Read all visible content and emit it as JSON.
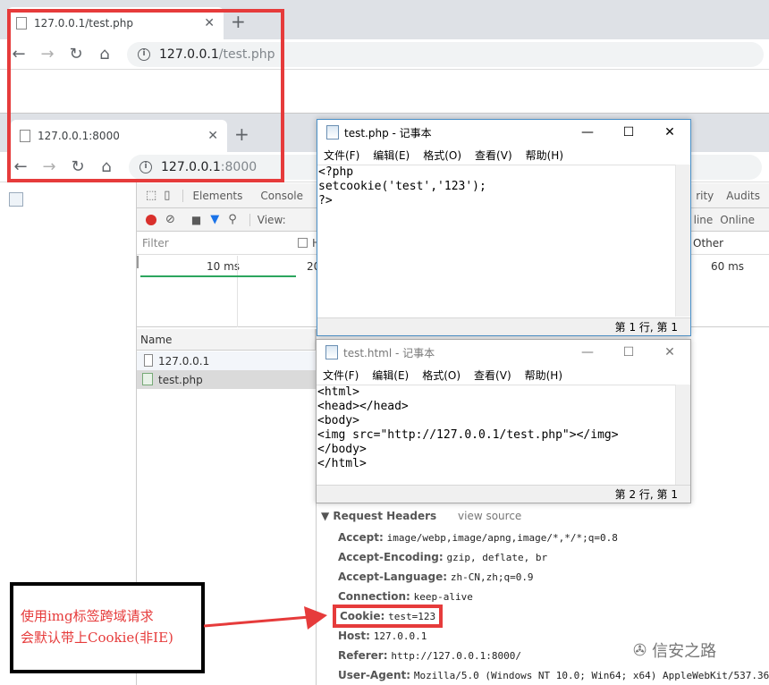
{
  "browser1": {
    "tab_title": "127.0.0.1/test.php",
    "url_host": "127.0.0.1",
    "url_path": "/test.php"
  },
  "browser2": {
    "tab_title": "127.0.0.1:8000",
    "url_host": "127.0.0.1",
    "url_path": ":8000"
  },
  "devtools": {
    "tabs": [
      "Elements",
      "Console"
    ],
    "right_tabs": [
      "rity",
      "Audits"
    ],
    "view_label": "View:",
    "throttle_right": [
      "line",
      "Online"
    ],
    "filter_placeholder": "Filter",
    "filter_h": "H",
    "other_label": "Other",
    "timeline_ticks": [
      "10 ms",
      "20",
      "60 ms"
    ],
    "name_header": "Name",
    "requests": [
      "127.0.0.1",
      "test.php"
    ]
  },
  "request_headers": {
    "title": "▼ Request Headers",
    "view_source": "view source",
    "rows": [
      {
        "k": "Accept:",
        "v": "image/webp,image/apng,image/*,*/*;q=0.8"
      },
      {
        "k": "Accept-Encoding:",
        "v": "gzip, deflate, br"
      },
      {
        "k": "Accept-Language:",
        "v": "zh-CN,zh;q=0.9"
      },
      {
        "k": "Connection:",
        "v": "keep-alive"
      },
      {
        "k": "Cookie:",
        "v": "test=123"
      },
      {
        "k": "Host:",
        "v": "127.0.0.1"
      },
      {
        "k": "Referer:",
        "v": "http://127.0.0.1:8000/"
      },
      {
        "k": "User-Agent:",
        "v": "Mozilla/5.0 (Windows NT 10.0; Win64; x64) AppleWebKit/537.36 ("
      }
    ]
  },
  "notepad1": {
    "title": "test.php - 记事本",
    "menu": [
      "文件(F)",
      "编辑(E)",
      "格式(O)",
      "查看(V)",
      "帮助(H)"
    ],
    "lines": [
      "<?php",
      "setcookie('test','123');",
      "?>"
    ],
    "status": "第 1 行, 第 1"
  },
  "notepad2": {
    "title": "test.html - 记事本",
    "menu": [
      "文件(F)",
      "编辑(E)",
      "格式(O)",
      "查看(V)",
      "帮助(H)"
    ],
    "lines": [
      "<html>",
      "<head></head>",
      "<body>",
      "<img src=\"http://127.0.0.1/test.php\"></img>",
      "</body>",
      "</html>"
    ],
    "status": "第 2 行, 第 1"
  },
  "annotation": {
    "line1": "使用img标签跨域请求",
    "line2": "会默认带上Cookie(非IE)"
  },
  "watermark": "信安之路",
  "colors": {
    "annotation_red": "#e63b3b"
  }
}
